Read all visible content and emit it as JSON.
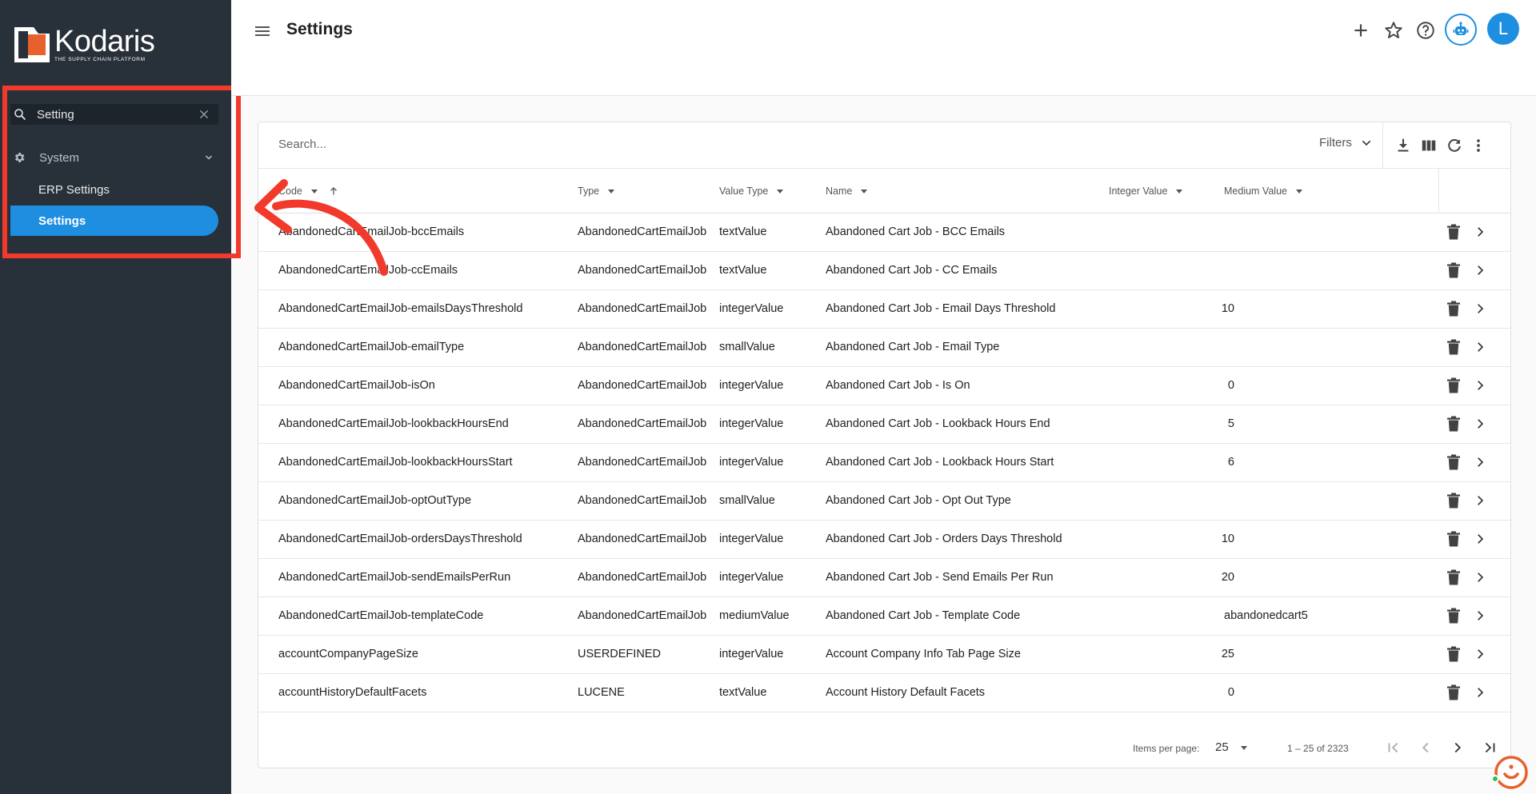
{
  "brand": {
    "name": "Kodaris",
    "tagline": "THE SUPPLY CHAIN PLATFORM"
  },
  "sidebar": {
    "search_value": "Setting",
    "group_label": "System",
    "items": [
      {
        "label": "ERP Settings"
      },
      {
        "label": "Settings"
      }
    ]
  },
  "header": {
    "title": "Settings",
    "avatar_initial": "L"
  },
  "toolbar": {
    "search_placeholder": "Search...",
    "filters_label": "Filters"
  },
  "columns": [
    {
      "label": "Code"
    },
    {
      "label": "Type"
    },
    {
      "label": "Value Type"
    },
    {
      "label": "Name"
    },
    {
      "label": "Integer Value"
    },
    {
      "label": "Medium Value"
    }
  ],
  "rows": [
    {
      "code": "AbandonedCartEmailJob-bccEmails",
      "type": "AbandonedCartEmailJob",
      "value_type": "textValue",
      "name": "Abandoned Cart Job - BCC Emails",
      "integer": "",
      "medium": ""
    },
    {
      "code": "AbandonedCartEmailJob-ccEmails",
      "type": "AbandonedCartEmailJob",
      "value_type": "textValue",
      "name": "Abandoned Cart Job - CC Emails",
      "integer": "",
      "medium": ""
    },
    {
      "code": "AbandonedCartEmailJob-emailsDaysThreshold",
      "type": "AbandonedCartEmailJob",
      "value_type": "integerValue",
      "name": "Abandoned Cart Job - Email Days Threshold",
      "integer": "10",
      "medium": ""
    },
    {
      "code": "AbandonedCartEmailJob-emailType",
      "type": "AbandonedCartEmailJob",
      "value_type": "smallValue",
      "name": "Abandoned Cart Job - Email Type",
      "integer": "",
      "medium": ""
    },
    {
      "code": "AbandonedCartEmailJob-isOn",
      "type": "AbandonedCartEmailJob",
      "value_type": "integerValue",
      "name": "Abandoned Cart Job - Is On",
      "integer": "0",
      "medium": ""
    },
    {
      "code": "AbandonedCartEmailJob-lookbackHoursEnd",
      "type": "AbandonedCartEmailJob",
      "value_type": "integerValue",
      "name": "Abandoned Cart Job - Lookback Hours End",
      "integer": "5",
      "medium": ""
    },
    {
      "code": "AbandonedCartEmailJob-lookbackHoursStart",
      "type": "AbandonedCartEmailJob",
      "value_type": "integerValue",
      "name": "Abandoned Cart Job - Lookback Hours Start",
      "integer": "6",
      "medium": ""
    },
    {
      "code": "AbandonedCartEmailJob-optOutType",
      "type": "AbandonedCartEmailJob",
      "value_type": "smallValue",
      "name": "Abandoned Cart Job - Opt Out Type",
      "integer": "",
      "medium": ""
    },
    {
      "code": "AbandonedCartEmailJob-ordersDaysThreshold",
      "type": "AbandonedCartEmailJob",
      "value_type": "integerValue",
      "name": "Abandoned Cart Job - Orders Days Threshold",
      "integer": "10",
      "medium": ""
    },
    {
      "code": "AbandonedCartEmailJob-sendEmailsPerRun",
      "type": "AbandonedCartEmailJob",
      "value_type": "integerValue",
      "name": "Abandoned Cart Job - Send Emails Per Run",
      "integer": "20",
      "medium": ""
    },
    {
      "code": "AbandonedCartEmailJob-templateCode",
      "type": "AbandonedCartEmailJob",
      "value_type": "mediumValue",
      "name": "Abandoned Cart Job - Template Code",
      "integer": "",
      "medium": "abandonedcart5"
    },
    {
      "code": "accountCompanyPageSize",
      "type": "USERDEFINED",
      "value_type": "integerValue",
      "name": "Account Company Info Tab Page Size",
      "integer": "25",
      "medium": ""
    },
    {
      "code": "accountHistoryDefaultFacets",
      "type": "LUCENE",
      "value_type": "textValue",
      "name": "Account History Default Facets",
      "integer": "0",
      "medium": ""
    }
  ],
  "pagination": {
    "items_per_page_label": "Items per page:",
    "items_per_page": "25",
    "range": "1 – 25 of 2323"
  },
  "colors": {
    "sidebar_bg": "#283039",
    "accent": "#1e8ee0",
    "annotation": "#f23a2c"
  },
  "icons": {
    "search": "search-icon",
    "clear": "close-icon",
    "gear": "gear-icon",
    "menu": "hamburger-menu-icon",
    "add": "plus-icon",
    "favorite": "star-icon",
    "help": "help-circle-icon",
    "assistant": "robot-icon",
    "download": "download-icon",
    "columns": "columns-icon",
    "refresh": "refresh-icon",
    "more": "more-vertical-icon",
    "delete": "trash-icon",
    "open": "chevron-right-icon"
  }
}
